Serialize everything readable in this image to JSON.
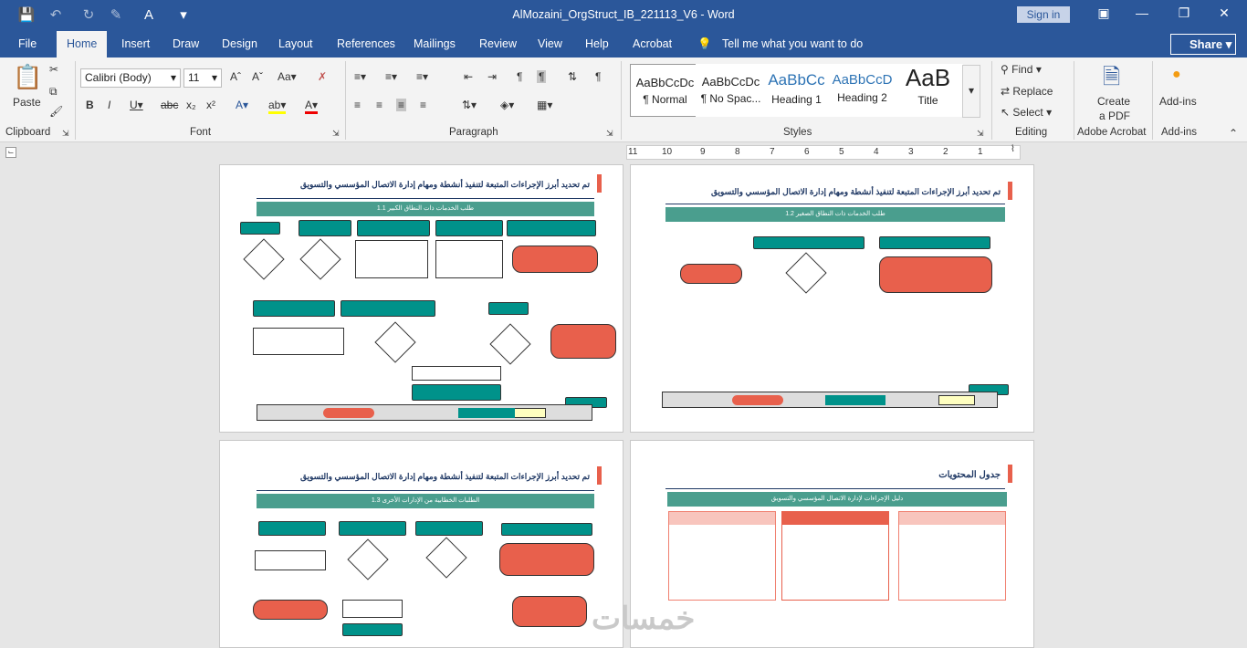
{
  "window": {
    "title": "AlMozaini_OrgStruct_IB_221113_V6  -  Word",
    "signin": "Sign in"
  },
  "tabs": [
    "File",
    "Home",
    "Insert",
    "Draw",
    "Design",
    "Layout",
    "References",
    "Mailings",
    "Review",
    "View",
    "Help",
    "Acrobat"
  ],
  "tell_me": "Tell me what you want to do",
  "share": "Share",
  "ribbon": {
    "paste": "Paste",
    "font_name": "Calibri (Body)",
    "font_size": "11",
    "groups": {
      "clipboard": "Clipboard",
      "font": "Font",
      "paragraph": "Paragraph",
      "styles": "Styles",
      "editing": "Editing",
      "acrobat": "Adobe Acrobat",
      "addins": "Add-ins"
    },
    "styles": [
      {
        "preview": "AaBbCcDc",
        "name": "¶ Normal"
      },
      {
        "preview": "AaBbCcDc",
        "name": "¶ No Spac..."
      },
      {
        "preview": "AaBbCc",
        "name": "Heading 1"
      },
      {
        "preview": "AaBbCcD",
        "name": "Heading 2"
      },
      {
        "preview": "AaB",
        "name": "Title"
      }
    ],
    "find": "Find",
    "replace": "Replace",
    "select": "Select",
    "create_pdf_1": "Create",
    "create_pdf_2": "a PDF",
    "addins": "Add-ins"
  },
  "ruler": {
    "ticks": [
      "11",
      "10",
      "9",
      "8",
      "7",
      "6",
      "5",
      "4",
      "3",
      "2",
      "1"
    ]
  },
  "pages": {
    "p1": {
      "title": "تم تحديد أبرز الإجراءات المتبعة لتنفيذ أنشطة ومهام إدارة الاتصال المؤسسي والتسويق",
      "header": "1.1 طلب الخدمات ذات النطاق الكبير"
    },
    "p2": {
      "title": "تم تحديد أبرز الإجراءات المتبعة لتنفيذ أنشطة ومهام إدارة الاتصال المؤسسي والتسويق",
      "header": "1.2 طلب الخدمات ذات النطاق الصغير"
    },
    "p3": {
      "title": "تم تحديد أبرز الإجراءات المتبعة لتنفيذ أنشطة ومهام إدارة الاتصال المؤسسي والتسويق",
      "header": "1.3 الطلبات الخطابية من الإدارات الأخرى"
    },
    "p4": {
      "title": "جدول المحتويات",
      "header": "دليل الإجراءات لإدارة الاتصال المؤسسي والتسويق"
    }
  },
  "watermark": "خمسات"
}
